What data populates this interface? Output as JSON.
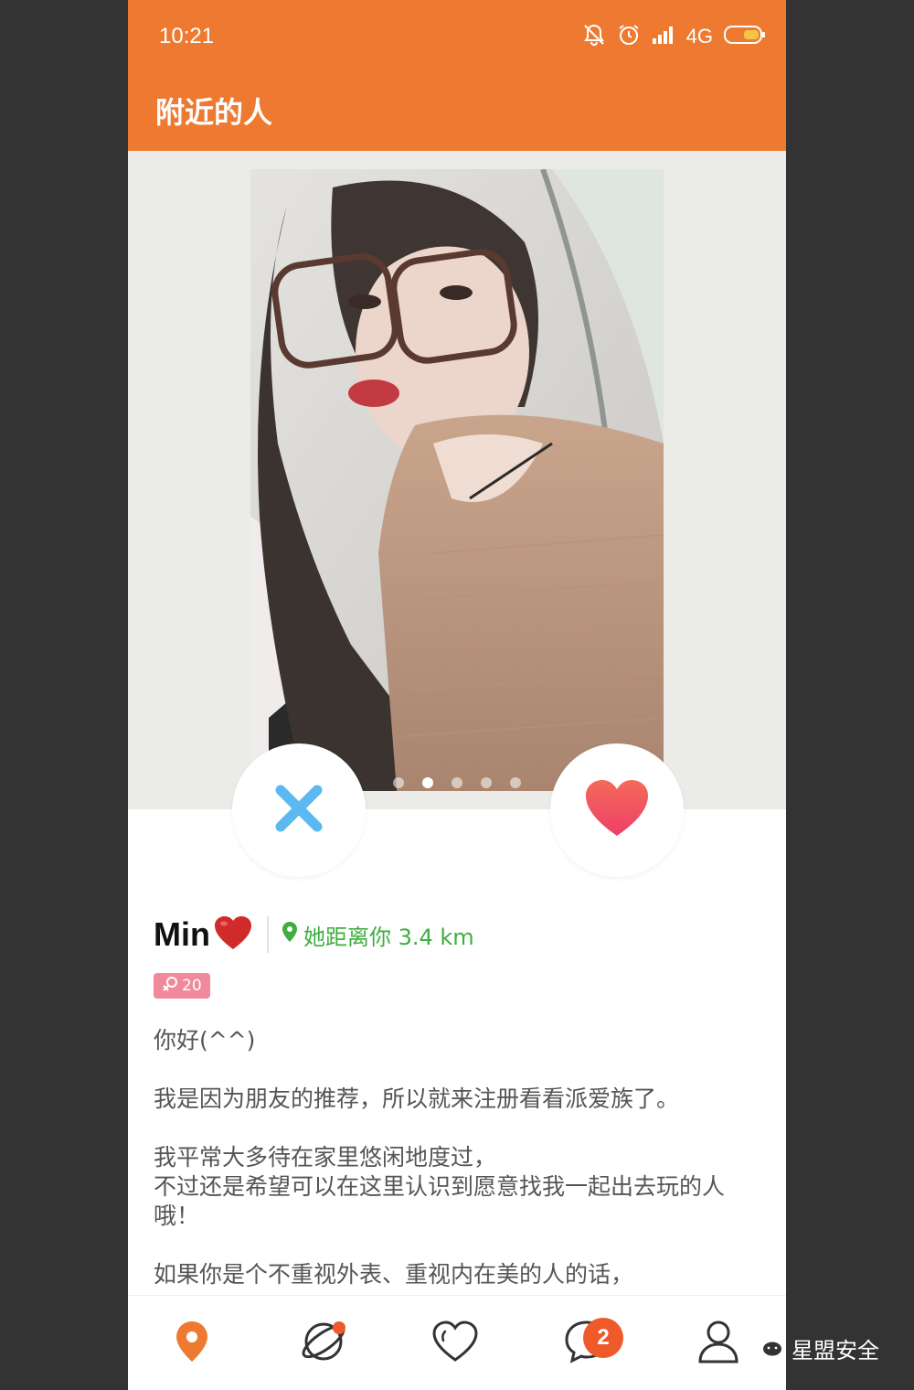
{
  "status_bar": {
    "time": "10:21",
    "network": "4G"
  },
  "app_bar": {
    "title": "附近的人"
  },
  "photo_carousel": {
    "total_dots": 5,
    "active_index": 1
  },
  "actions": {
    "pass_icon": "close-icon",
    "like_icon": "heart-icon"
  },
  "profile": {
    "name": "Min",
    "distance": "她距离你 3.4 km",
    "age": "20",
    "bio": [
      "你好(^^)",
      "我是因为朋友的推荐，所以就来注册看看派爱族了。",
      "我平常大多待在家里悠闲地度过，",
      "不过还是希望可以在这里认识到愿意找我一起出去玩的人哦！",
      "如果你是个不重视外表、重视内在美的人的话，"
    ]
  },
  "tab_bar": {
    "items": [
      {
        "icon": "location-pin-icon",
        "active": true
      },
      {
        "icon": "planet-icon",
        "has_dot": true
      },
      {
        "icon": "heart-outline-icon"
      },
      {
        "icon": "chat-bubble-icon",
        "badge": "2"
      },
      {
        "icon": "user-icon"
      }
    ]
  },
  "watermark": {
    "text": "星盟安全"
  },
  "colors": {
    "accent": "#ee7a31",
    "distance_green": "#3fae3f",
    "badge_pink": "#f08a9b",
    "pass_blue": "#5bb8f0",
    "like_red": "#f2545b"
  }
}
